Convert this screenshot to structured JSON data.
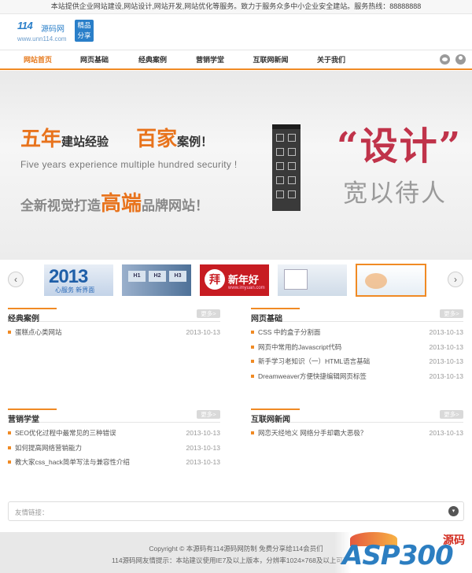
{
  "topbar": {
    "text": "本站提供企业网站建设,网站设计,网站开发,网站优化等服务。致力于服务众多中小企业安全建站。服务热线：88888888"
  },
  "logo": {
    "brand_num": "114",
    "brand_cn": "源码网",
    "url": "www.unn114.com",
    "badge_line1": "精品",
    "badge_line2": "分享"
  },
  "nav": {
    "items": [
      {
        "label": "网站首页",
        "active": true
      },
      {
        "label": "网页基础",
        "active": false
      },
      {
        "label": "经典案例",
        "active": false
      },
      {
        "label": "营销学堂",
        "active": false
      },
      {
        "label": "互联网新闻",
        "active": false
      },
      {
        "label": "关于我们",
        "active": false
      }
    ],
    "icons": [
      "eye-icon",
      "user-icon"
    ]
  },
  "banner": {
    "l1_a": "五年",
    "l1_b": "建站经验",
    "l1_c": "百家",
    "l1_d": "案例！",
    "english": "Five years experience multiple hundred security !",
    "l3_a": "全新视觉打造",
    "l3_b": "高端",
    "l3_c": "品牌网站！",
    "sheji": "“设计”",
    "kuan": "宽以待人"
  },
  "thumbs": {
    "prev": "‹",
    "next": "›",
    "t1_big": "2013",
    "t1_small": "心服务 新界面",
    "t2_labels": [
      "H1",
      "H2",
      "H3"
    ],
    "t3_char": "拜",
    "t3_text": "新年好",
    "t3_url": "www.imyuan.com"
  },
  "boxes": {
    "classic": {
      "title": "经典案例",
      "more": "更多>",
      "rows": [
        {
          "text": "蛋糕点心类网站",
          "date": "2013-10-13"
        }
      ]
    },
    "basics": {
      "title": "网页基础",
      "more": "更多>",
      "rows": [
        {
          "text": "CSS 中的盒子分割面",
          "date": "2013-10-13"
        },
        {
          "text": "网页中常用的Javascript代码",
          "date": "2013-10-13"
        },
        {
          "text": "新手学习老知识（一）HTML语言基础",
          "date": "2013-10-13"
        },
        {
          "text": "Dreamweaver方便快捷编辑网页标签",
          "date": "2013-10-13"
        }
      ]
    },
    "marketing": {
      "title": "营销学堂",
      "more": "更多>",
      "rows": [
        {
          "text": "SEO优化过程中最常见的三种错误",
          "date": "2013-10-13"
        },
        {
          "text": "如何提高网络营销能力",
          "date": "2013-10-13"
        },
        {
          "text": "教大家css_hack简单写法与兼容性介绍",
          "date": "2013-10-13"
        }
      ]
    },
    "news": {
      "title": "互联网新闻",
      "more": "更多>",
      "rows": [
        {
          "text": "网恋天经地义 网络分手却霸大恶极？",
          "date": "2013-10-13"
        }
      ]
    }
  },
  "links": {
    "label": "友情链接：",
    "toggle": "▾"
  },
  "footer": {
    "line1": "Copyright © 本源码有114源码网防制 免费分享给114会员们",
    "line2": "114源码网友情提示：本站建议使用IE7及以上版本，分辨率1024×768及以上可获得最佳"
  },
  "watermark": {
    "asp": "ASP300",
    "yuan": "源码"
  },
  "colors": {
    "accent": "#f08a24",
    "brand_blue": "#2a7fc9",
    "title_red": "#c0334a"
  }
}
